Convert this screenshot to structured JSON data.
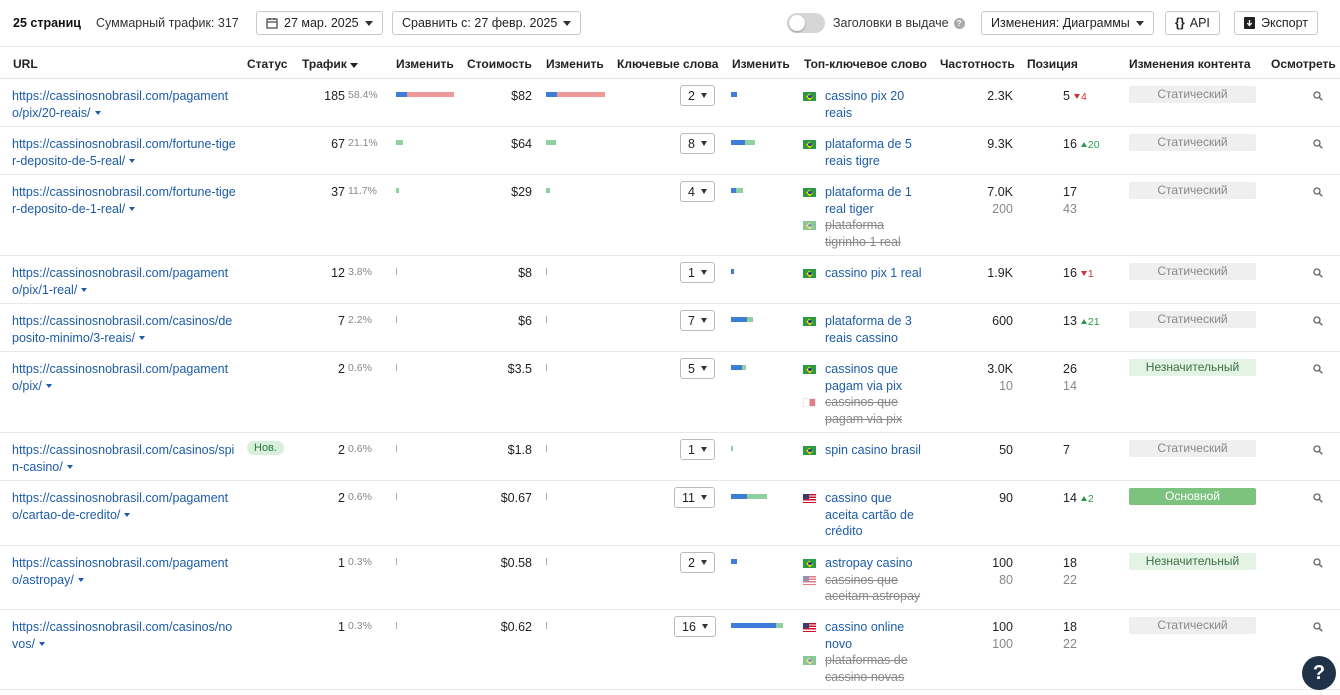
{
  "toolbar": {
    "pages_count": "25 страниц",
    "total_traffic": "Суммарный трафик: 317",
    "date": "27 мар. 2025",
    "compare": "Сравнить с: 27 февр. 2025",
    "serp_titles_label": "Заголовки в выдаче",
    "changes_label": "Изменения:",
    "changes_value": "Диаграммы",
    "api_label": "API",
    "export_label": "Экспорт"
  },
  "headers": {
    "url": "URL",
    "status": "Статус",
    "traffic": "Трафик",
    "change1": "Изменить",
    "cost": "Стоимость",
    "change2": "Изменить",
    "keywords": "Ключевые слова",
    "change3": "Изменить",
    "top_keyword": "Топ-ключевое слово",
    "volume": "Частотность",
    "position": "Позиция",
    "content_changes": "Изменения контента",
    "inspect": "Осмотреть"
  },
  "colors": {
    "link": "#1d5ca8",
    "bar_blue": "#3b7dd8",
    "bar_red": "#ef9a9a",
    "bar_green": "#8fd19e",
    "green_badge": "#7cc37f"
  },
  "rows": [
    {
      "url": "https://cassinosnobrasil.com/pagamento/pix/20-reais/",
      "status": "",
      "traffic": "185",
      "traffic_pct": "58.4%",
      "tbar": [
        {
          "c": "bar_blue",
          "w": 0.12
        },
        {
          "c": "bar_red",
          "w": 0.53
        }
      ],
      "cost": "$82",
      "cbar": [
        {
          "c": "bar_blue",
          "w": 0.12
        },
        {
          "c": "bar_red",
          "w": 0.54
        }
      ],
      "keywords": "2",
      "kbar": [
        {
          "c": "bar_blue",
          "w": 0.09
        }
      ],
      "kw": [
        {
          "flag": "br",
          "text": "cassino pix 20 reais",
          "sec": false
        }
      ],
      "volume": [
        "2.3K"
      ],
      "position": [
        "5"
      ],
      "pos_change": {
        "dir": "down",
        "val": "4"
      },
      "content": "Статический",
      "ctype": "static"
    },
    {
      "url": "https://cassinosnobrasil.com/fortune-tiger-deposito-de-5-real/",
      "status": "",
      "traffic": "67",
      "traffic_pct": "21.1%",
      "tbar": [
        {
          "c": "bar_green",
          "w": 0.08
        }
      ],
      "cost": "$64",
      "cbar": [
        {
          "c": "bar_green",
          "w": 0.11
        }
      ],
      "keywords": "8",
      "kbar": [
        {
          "c": "bar_blue",
          "w": 0.22
        },
        {
          "c": "bar_green",
          "w": 0.16
        }
      ],
      "kw": [
        {
          "flag": "br",
          "text": "plataforma de 5 reais tigre",
          "sec": false
        }
      ],
      "volume": [
        "9.3K"
      ],
      "position": [
        "16"
      ],
      "pos_change": {
        "dir": "up",
        "val": "20"
      },
      "content": "Статический",
      "ctype": "static"
    },
    {
      "url": "https://cassinosnobrasil.com/fortune-tiger-deposito-de-1-real/",
      "status": "",
      "traffic": "37",
      "traffic_pct": "11.7%",
      "tbar": [
        {
          "c": "bar_green",
          "w": 0.03
        }
      ],
      "cost": "$29",
      "cbar": [
        {
          "c": "bar_green",
          "w": 0.05
        }
      ],
      "keywords": "4",
      "kbar": [
        {
          "c": "bar_blue",
          "w": 0.08
        },
        {
          "c": "bar_green",
          "w": 0.12
        }
      ],
      "kw": [
        {
          "flag": "br",
          "text": "plataforma de 1 real tiger",
          "sec": false
        },
        {
          "flag": "br",
          "text": "plataforma tigrinho 1 real",
          "sec": true
        }
      ],
      "volume": [
        "7.0K",
        "200"
      ],
      "position": [
        "17",
        "43"
      ],
      "pos_change": null,
      "content": "Статический",
      "ctype": "static"
    },
    {
      "url": "https://cassinosnobrasil.com/pagamento/pix/1-real/",
      "status": "",
      "traffic": "12",
      "traffic_pct": "3.8%",
      "tbar": [],
      "cost": "$8",
      "cbar": [],
      "keywords": "1",
      "kbar": [
        {
          "c": "bar_blue",
          "w": 0.05
        }
      ],
      "kw": [
        {
          "flag": "br",
          "text": "cassino pix 1 real",
          "sec": false
        }
      ],
      "volume": [
        "1.9K"
      ],
      "position": [
        "16"
      ],
      "pos_change": {
        "dir": "down",
        "val": "1"
      },
      "content": "Статический",
      "ctype": "static"
    },
    {
      "url": "https://cassinosnobrasil.com/casinos/deposito-minimo/3-reais/",
      "status": "",
      "traffic": "7",
      "traffic_pct": "2.2%",
      "tbar": [],
      "cost": "$6",
      "cbar": [],
      "keywords": "7",
      "kbar": [
        {
          "c": "bar_blue",
          "w": 0.25
        },
        {
          "c": "bar_green",
          "w": 0.1
        }
      ],
      "kw": [
        {
          "flag": "br",
          "text": "plataforma de 3 reais cassino",
          "sec": false
        }
      ],
      "volume": [
        "600"
      ],
      "position": [
        "13"
      ],
      "pos_change": {
        "dir": "up",
        "val": "21"
      },
      "content": "Статический",
      "ctype": "static"
    },
    {
      "url": "https://cassinosnobrasil.com/pagamento/pix/",
      "status": "",
      "traffic": "2",
      "traffic_pct": "0.6%",
      "tbar": [],
      "cost": "$3.5",
      "cbar": [],
      "keywords": "5",
      "kbar": [
        {
          "c": "bar_blue",
          "w": 0.18
        },
        {
          "c": "bar_green",
          "w": 0.07
        }
      ],
      "kw": [
        {
          "flag": "br",
          "text": "cassinos que pagam via pix",
          "sec": false
        },
        {
          "flag": "mt",
          "text": "cassinos que pagam via pix",
          "sec": true
        }
      ],
      "volume": [
        "3.0K",
        "10"
      ],
      "position": [
        "26",
        "14"
      ],
      "pos_change": null,
      "content": "Незначительный",
      "ctype": "minor"
    },
    {
      "url": "https://cassinosnobrasil.com/casinos/spin-casino/",
      "status": "Нов.",
      "traffic": "2",
      "traffic_pct": "0.6%",
      "tbar": [],
      "cost": "$1.8",
      "cbar": [],
      "keywords": "1",
      "kbar": [
        {
          "c": "bar_green",
          "w": 0.04
        }
      ],
      "kw": [
        {
          "flag": "br",
          "text": "spin casino brasil",
          "sec": false
        }
      ],
      "volume": [
        "50"
      ],
      "position": [
        "7"
      ],
      "pos_change": null,
      "content": "Статический",
      "ctype": "static"
    },
    {
      "url": "https://cassinosnobrasil.com/pagamento/cartao-de-credito/",
      "status": "",
      "traffic": "2",
      "traffic_pct": "0.6%",
      "tbar": [],
      "cost": "$0.67",
      "cbar": [],
      "keywords": "11",
      "kbar": [
        {
          "c": "bar_blue",
          "w": 0.25
        },
        {
          "c": "bar_green",
          "w": 0.33
        }
      ],
      "kw": [
        {
          "flag": "us",
          "text": "cassino que aceita cartão de crédito",
          "sec": false
        }
      ],
      "volume": [
        "90"
      ],
      "position": [
        "14"
      ],
      "pos_change": {
        "dir": "up",
        "val": "2"
      },
      "content": "Основной",
      "ctype": "major"
    },
    {
      "url": "https://cassinosnobrasil.com/pagamento/astropay/",
      "status": "",
      "traffic": "1",
      "traffic_pct": "0.3%",
      "tbar": [],
      "cost": "$0.58",
      "cbar": [],
      "keywords": "2",
      "kbar": [
        {
          "c": "bar_blue",
          "w": 0.09
        }
      ],
      "kw": [
        {
          "flag": "br",
          "text": "astropay casino",
          "sec": false
        },
        {
          "flag": "us",
          "text": "cassinos que aceitam astropay",
          "sec": true
        }
      ],
      "volume": [
        "100",
        "80"
      ],
      "position": [
        "18",
        "22"
      ],
      "pos_change": null,
      "content": "Незначительный",
      "ctype": "minor"
    },
    {
      "url": "https://cassinosnobrasil.com/casinos/novos/",
      "status": "",
      "traffic": "1",
      "traffic_pct": "0.3%",
      "tbar": [],
      "cost": "$0.62",
      "cbar": [],
      "keywords": "16",
      "kbar": [
        {
          "c": "bar_blue",
          "w": 0.72
        },
        {
          "c": "bar_green",
          "w": 0.12
        }
      ],
      "kw": [
        {
          "flag": "us",
          "text": "cassino online novo",
          "sec": false
        },
        {
          "flag": "br",
          "text": "plataformas de cassino novas",
          "sec": true
        }
      ],
      "volume": [
        "100",
        "100"
      ],
      "position": [
        "18",
        "22"
      ],
      "pos_change": null,
      "content": "Статический",
      "ctype": "static"
    }
  ],
  "help_label": "?"
}
